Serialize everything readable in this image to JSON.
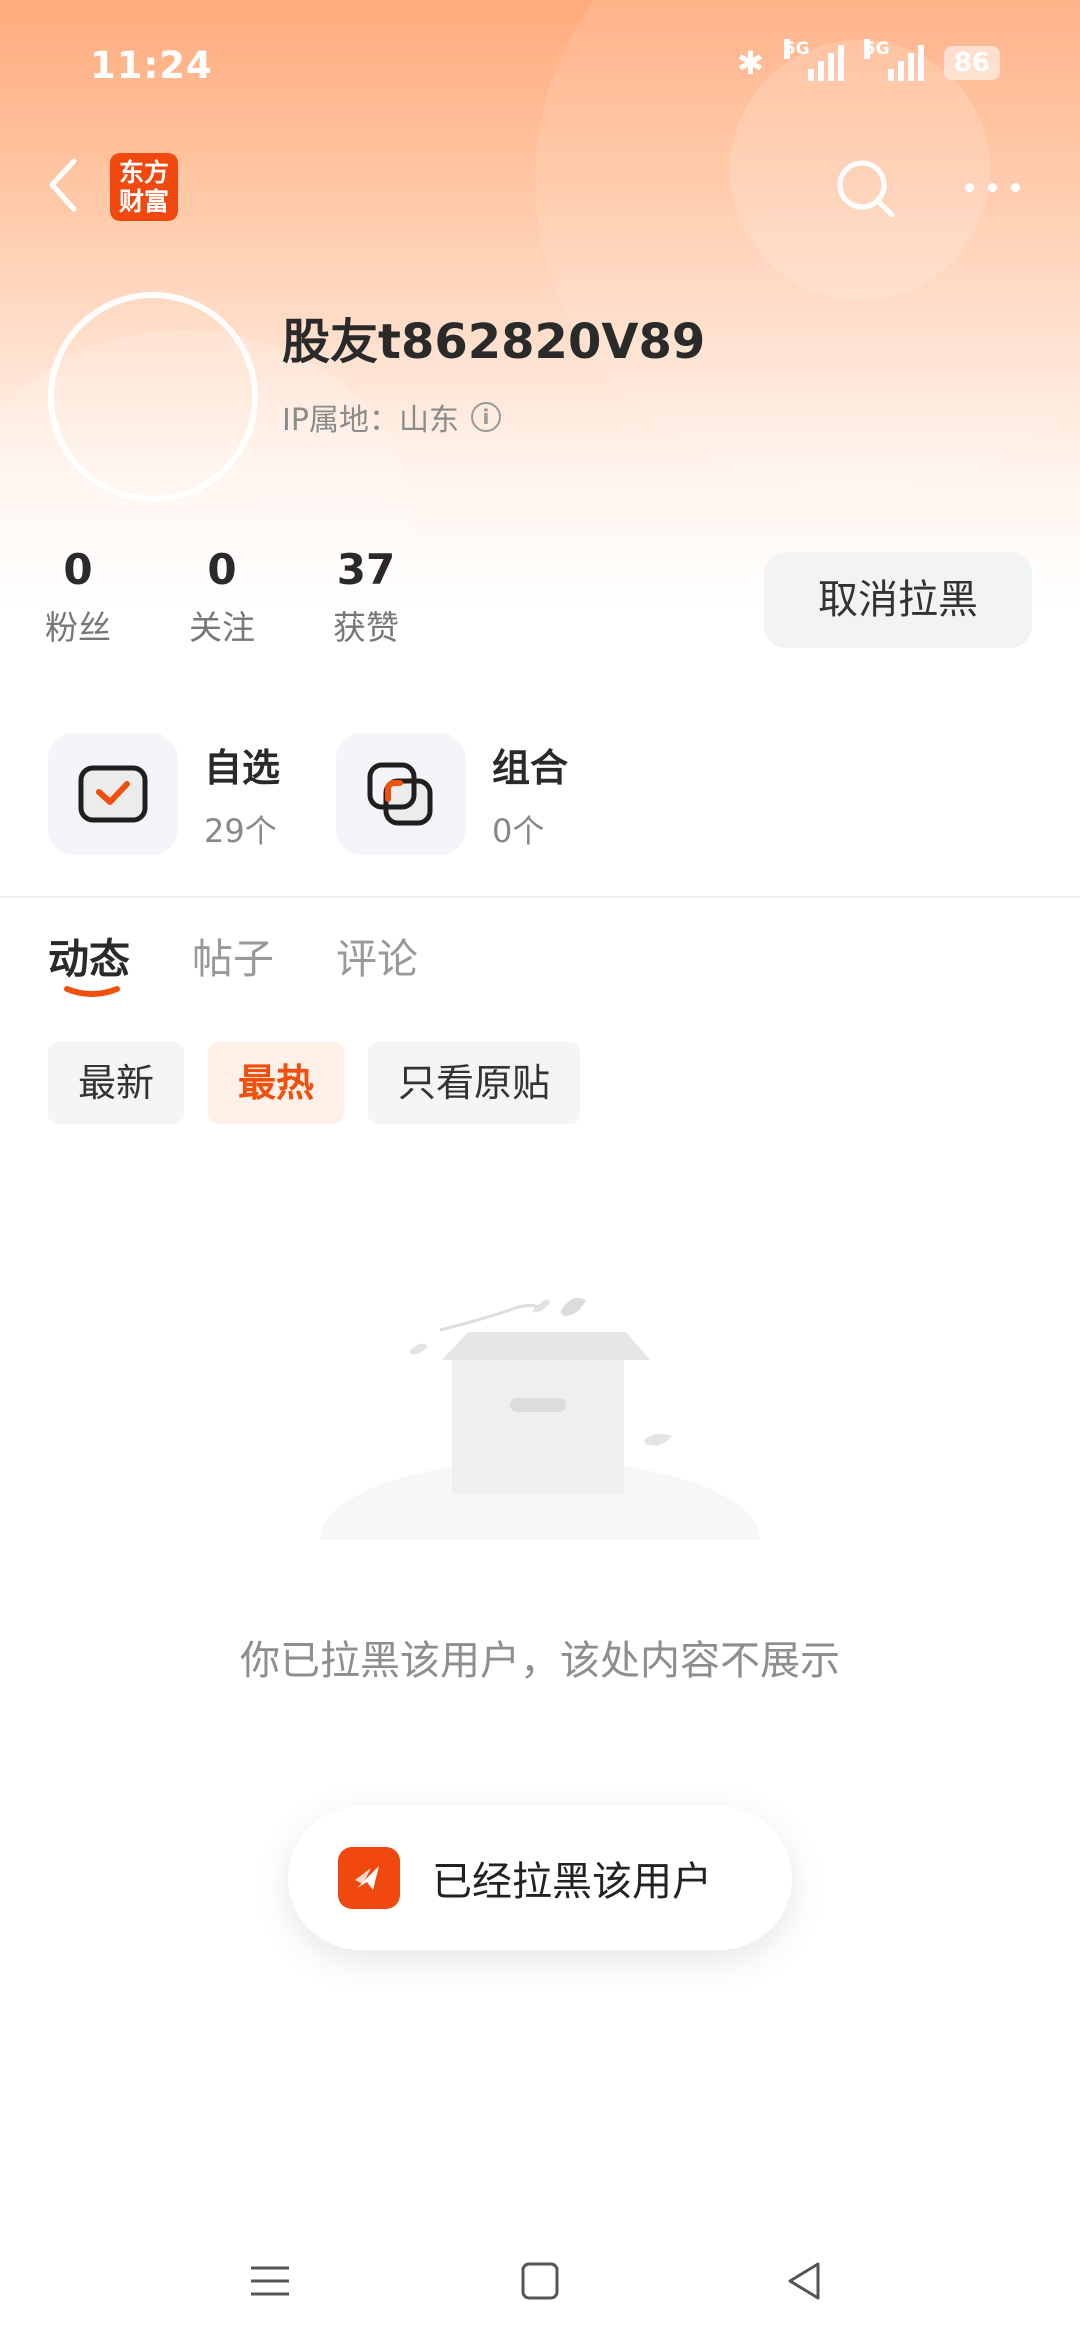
{
  "status_bar": {
    "time": "11:24",
    "network1": "5G",
    "network2": "5G",
    "battery": "86"
  },
  "nav": {
    "logo_line1": "东方",
    "logo_line2": "财富",
    "brand_color": "#f0480f"
  },
  "profile": {
    "username": "股友t862820V89",
    "ip_label": "IP属地：山东",
    "stats": [
      {
        "value": "0",
        "label": "粉丝"
      },
      {
        "value": "0",
        "label": "关注"
      },
      {
        "value": "37",
        "label": "获赞"
      }
    ],
    "unblock_button": "取消拉黑"
  },
  "quick_entries": [
    {
      "title": "自选",
      "count": "29个",
      "icon": "watchlist-check-icon"
    },
    {
      "title": "组合",
      "count": "0个",
      "icon": "portfolio-overlap-icon"
    }
  ],
  "tabs": [
    {
      "label": "动态",
      "active": true
    },
    {
      "label": "帖子",
      "active": false
    },
    {
      "label": "评论",
      "active": false
    }
  ],
  "filters": [
    {
      "label": "最新",
      "active": false
    },
    {
      "label": "最热",
      "active": true
    },
    {
      "label": "只看原贴",
      "active": false
    }
  ],
  "empty_state": {
    "message": "你已拉黑该用户，该处内容不展示",
    "icon": "empty-box-icon"
  },
  "toast": {
    "message": "已经拉黑该用户",
    "icon": "app-logo-icon"
  },
  "accent_color": "#f0500e"
}
